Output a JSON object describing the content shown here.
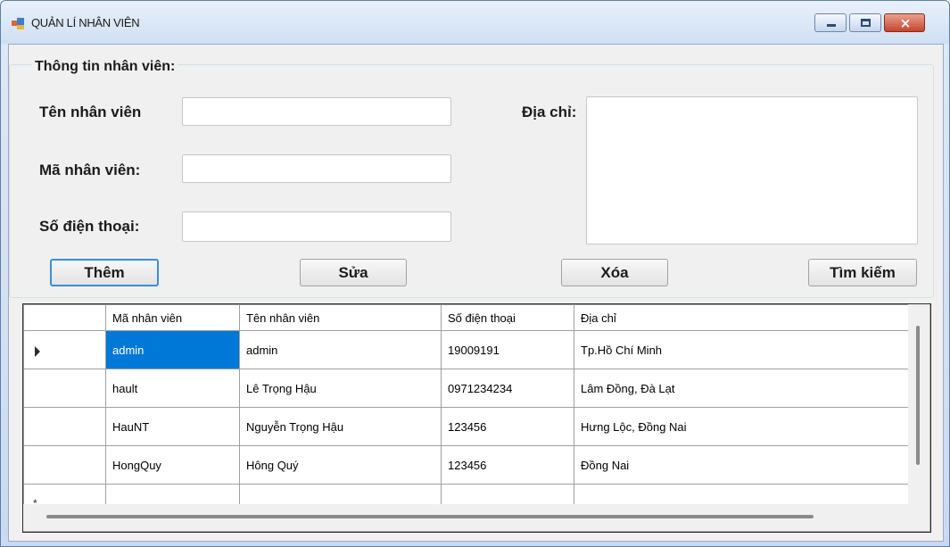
{
  "window": {
    "title": "QUẢN LÍ NHÂN VIÊN",
    "close_glyph": "×"
  },
  "form": {
    "group_title": "Thông tin nhân viên:",
    "labels": {
      "name": "Tên nhân viên",
      "id": "Mã nhân viên:",
      "phone": "Số điện thoại:",
      "address": "Địa chỉ:"
    },
    "values": {
      "name": "",
      "id": "",
      "phone": "",
      "address": ""
    }
  },
  "buttons": {
    "add": "Thêm",
    "edit": "Sửa",
    "delete": "Xóa",
    "search": "Tìm kiếm"
  },
  "grid": {
    "columns": [
      "Mã nhân viên",
      "Tên nhân viên",
      "Số điện thoại",
      "Địa chỉ"
    ],
    "rows": [
      [
        "admin",
        "admin",
        "19009191",
        "Tp.Hồ Chí Minh"
      ],
      [
        "hault",
        "Lê Trọng Hậu",
        "0971234234",
        "Lâm Đồng, Đà Lạt"
      ],
      [
        "HauNT",
        "Nguyễn Trọng Hậu",
        "123456",
        "Hưng Lộc, Đồng Nai"
      ],
      [
        "HongQuy",
        "Hông Quý",
        "123456",
        "Đồng Nai"
      ]
    ],
    "new_row_marker": "*",
    "selected_cell": "admin"
  }
}
